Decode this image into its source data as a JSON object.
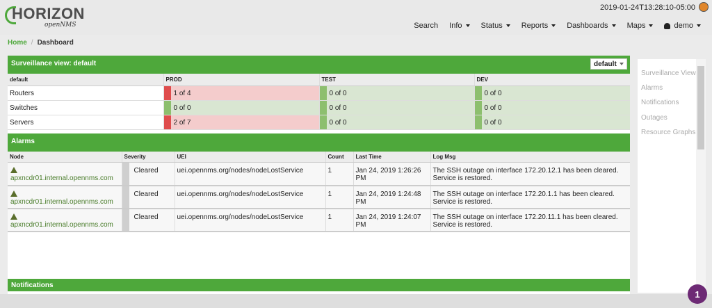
{
  "header": {
    "logo_main": "HORIZON",
    "logo_sub": "openNMS",
    "timestamp": "2019-01-24T13:28:10-05:00",
    "nav": {
      "search": "Search",
      "info": "Info",
      "status": "Status",
      "reports": "Reports",
      "dashboards": "Dashboards",
      "maps": "Maps",
      "user": "demo"
    }
  },
  "breadcrumb": {
    "home": "Home",
    "current": "Dashboard"
  },
  "surveillance": {
    "title": "Surveillance view: default",
    "select_value": "default",
    "columns": [
      "default",
      "PROD",
      "TEST",
      "DEV"
    ],
    "rows": [
      {
        "label": "Routers",
        "cells": [
          {
            "text": "1 of 4",
            "status": "bad"
          },
          {
            "text": "0 of 0",
            "status": "ok"
          },
          {
            "text": "0 of 0",
            "status": "ok"
          }
        ]
      },
      {
        "label": "Switches",
        "cells": [
          {
            "text": "0 of 0",
            "status": "ok"
          },
          {
            "text": "0 of 0",
            "status": "ok"
          },
          {
            "text": "0 of 0",
            "status": "ok"
          }
        ]
      },
      {
        "label": "Servers",
        "cells": [
          {
            "text": "2 of 7",
            "status": "bad"
          },
          {
            "text": "0 of 0",
            "status": "ok"
          },
          {
            "text": "0 of 0",
            "status": "ok"
          }
        ]
      }
    ]
  },
  "alarms": {
    "title": "Alarms",
    "columns": [
      "Node",
      "Severity",
      "UEI",
      "Count",
      "Last Time",
      "Log Msg"
    ],
    "rows": [
      {
        "node": "apxncdr01.internal.opennms.com",
        "severity": "Cleared",
        "uei": "uei.opennms.org/nodes/nodeLostService",
        "count": "1",
        "last_time": "Jan 24, 2019 1:26:26 PM",
        "log_msg": "The SSH outage on interface 172.20.12.1 has been cleared. Service is restored."
      },
      {
        "node": "apxncdr01.internal.opennms.com",
        "severity": "Cleared",
        "uei": "uei.opennms.org/nodes/nodeLostService",
        "count": "1",
        "last_time": "Jan 24, 2019 1:24:48 PM",
        "log_msg": "The SSH outage on interface 172.20.1.1 has been cleared. Service is restored."
      },
      {
        "node": "apxncdr01.internal.opennms.com",
        "severity": "Cleared",
        "uei": "uei.opennms.org/nodes/nodeLostService",
        "count": "1",
        "last_time": "Jan 24, 2019 1:24:07 PM",
        "log_msg": "The SSH outage on interface 172.20.11.1 has been cleared. Service is restored."
      }
    ]
  },
  "notifications": {
    "title": "Notifications"
  },
  "sidebar": {
    "items": [
      "Surveillance View",
      "Alarms",
      "Notifications",
      "Outages",
      "Resource Graphs"
    ]
  },
  "badge": {
    "count": "1"
  },
  "colors": {
    "accent": "#4ea83b",
    "bad": "#df4d4d",
    "ok": "#8dbf6e",
    "badge": "#6d2a75"
  }
}
